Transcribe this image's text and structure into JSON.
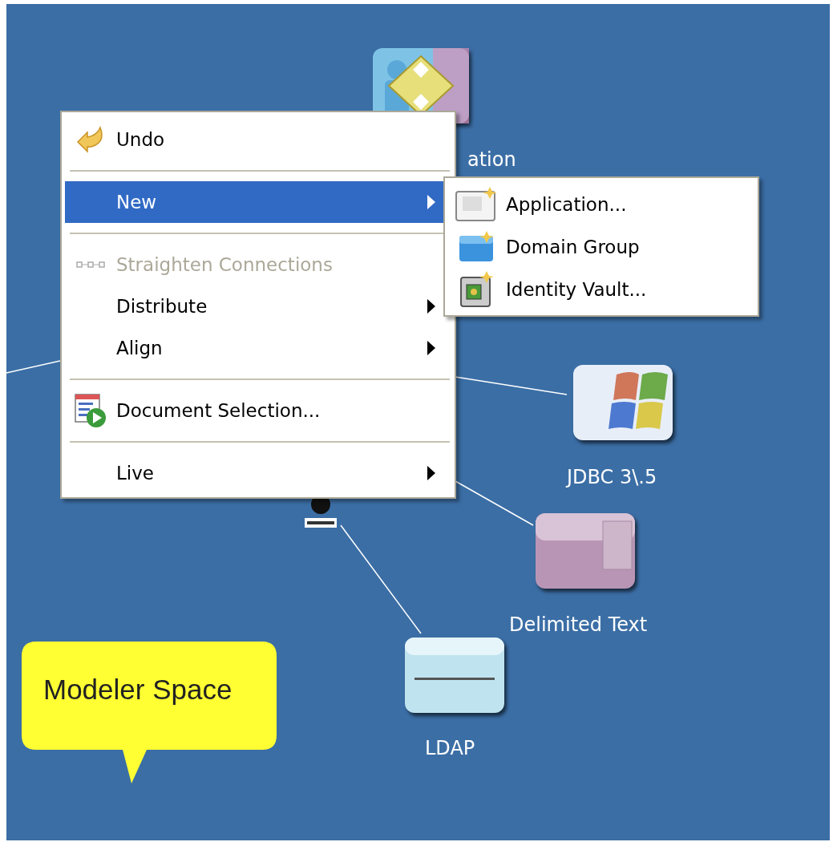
{
  "canvas": {
    "nodes": [
      {
        "label": "ation"
      },
      {
        "label": "JDBC 3\\.5"
      },
      {
        "label": "Delimited Text"
      },
      {
        "label": "LDAP"
      }
    ],
    "callout": {
      "text": "Modeler Space"
    }
  },
  "context_menu": {
    "items": [
      {
        "kind": "item",
        "label": "Undo",
        "selected": false,
        "disabled": false,
        "submenu": false
      },
      {
        "kind": "separator"
      },
      {
        "kind": "item",
        "label": "New",
        "selected": true,
        "disabled": false,
        "submenu": true
      },
      {
        "kind": "separator"
      },
      {
        "kind": "item",
        "label": "Straighten Connections",
        "selected": false,
        "disabled": true,
        "submenu": false
      },
      {
        "kind": "item",
        "label": "Distribute",
        "selected": false,
        "disabled": false,
        "submenu": true
      },
      {
        "kind": "item",
        "label": "Align",
        "selected": false,
        "disabled": false,
        "submenu": true
      },
      {
        "kind": "separator"
      },
      {
        "kind": "item",
        "label": "Document Selection...",
        "selected": false,
        "disabled": false,
        "submenu": false
      },
      {
        "kind": "separator"
      },
      {
        "kind": "item",
        "label": "Live",
        "selected": false,
        "disabled": false,
        "submenu": true
      }
    ]
  },
  "submenu": {
    "items": [
      {
        "label": "Application..."
      },
      {
        "label": "Domain Group"
      },
      {
        "label": "Identity Vault..."
      }
    ]
  }
}
